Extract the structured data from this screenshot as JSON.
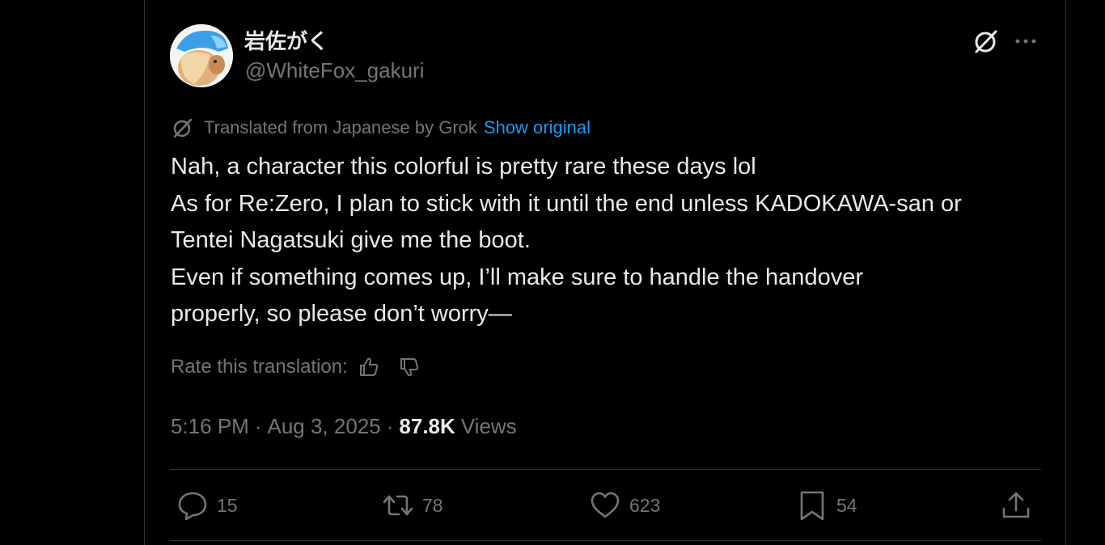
{
  "author": {
    "name": "岩佐がく",
    "handle": "@WhiteFox_gakuri"
  },
  "translation": {
    "note": "Translated from Japanese by Grok",
    "show_original": "Show original"
  },
  "tweet": {
    "lines": [
      "Nah, a character this colorful is pretty rare these days lol",
      "As for Re:Zero, I plan to stick with it until the end unless KADOKAWA-san or",
      "Tentei Nagatsuki give me the boot.",
      "Even if something comes up, I’ll make sure to handle the handover",
      "properly, so please don’t worry—"
    ]
  },
  "rating": {
    "label": "Rate this translation:"
  },
  "meta": {
    "time": "5:16 PM",
    "date": "Aug 3, 2025",
    "views_count": "87.8K",
    "views_label": "Views",
    "separator": "·"
  },
  "actions": {
    "replies": "15",
    "reposts": "78",
    "likes": "623",
    "bookmarks": "54"
  },
  "icons": {
    "grok": "grok-icon",
    "more": "more-icon",
    "reply": "reply-icon",
    "repost": "repost-icon",
    "like": "heart-icon",
    "bookmark": "bookmark-icon",
    "share": "share-icon"
  },
  "colors": {
    "background": "#000000",
    "text": "#e7e9ea",
    "secondary": "#71767b",
    "link": "#1d9bf0",
    "divider": "#2f3336"
  }
}
